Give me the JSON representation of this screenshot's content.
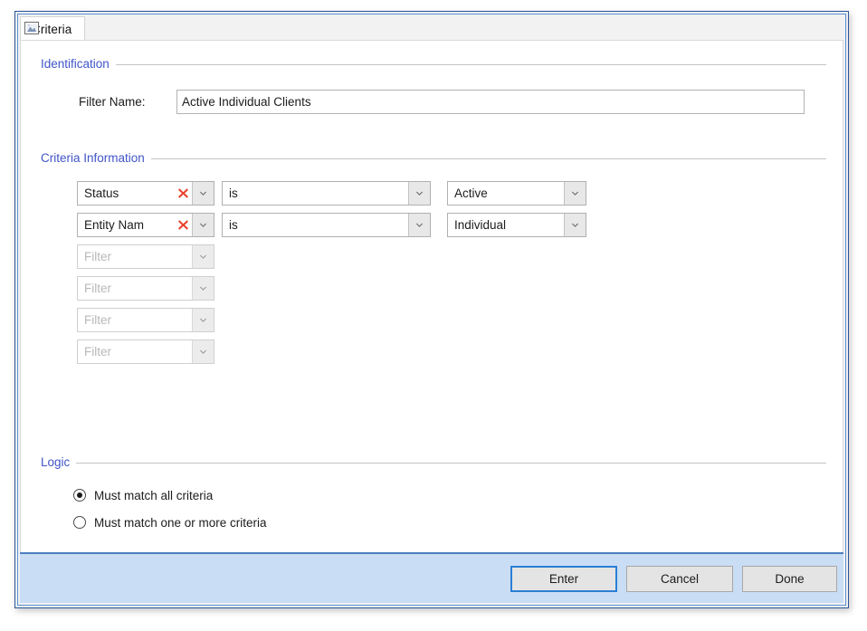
{
  "window": {
    "tab": {
      "label": "Criteria",
      "icon": "image-icon"
    }
  },
  "identification": {
    "legend": "Identification",
    "filter_name_label": "Filter Name:",
    "filter_name_value": "Active Individual Clients",
    "filter_name_placeholder": ""
  },
  "criteria": {
    "legend": "Criteria Information",
    "rows": [
      {
        "field": "Status",
        "field_enabled": true,
        "delete_icon": "red-x-delete-icon",
        "operator": "is",
        "operator_enabled": true,
        "value": "Active",
        "value_enabled": true
      },
      {
        "field": "Entity Nam",
        "field_enabled": true,
        "delete_icon": "red-x-delete-icon",
        "operator": "is",
        "operator_enabled": true,
        "value": "Individual",
        "value_enabled": true
      },
      {
        "field": "Filter",
        "field_enabled": false,
        "operator": "",
        "operator_enabled": false,
        "value": "",
        "value_enabled": false
      },
      {
        "field": "Filter",
        "field_enabled": false,
        "operator": "",
        "operator_enabled": false,
        "value": "",
        "value_enabled": false
      },
      {
        "field": "Filter",
        "field_enabled": false,
        "operator": "",
        "operator_enabled": false,
        "value": "",
        "value_enabled": false
      },
      {
        "field": "Filter",
        "field_enabled": false,
        "operator": "",
        "operator_enabled": false,
        "value": "",
        "value_enabled": false
      }
    ]
  },
  "logic": {
    "legend": "Logic",
    "options": [
      {
        "label": "Must match all criteria",
        "selected": true
      },
      {
        "label": "Must match one or more criteria",
        "selected": false
      }
    ]
  },
  "footer": {
    "enter_label": "Enter",
    "cancel_label": "Cancel",
    "done_label": "Done"
  },
  "colors": {
    "legend_blue": "#4055c8",
    "footer_blue": "#c9ddf5",
    "focus_blue": "#2a7fd4",
    "delete_red": "#e8412a"
  }
}
